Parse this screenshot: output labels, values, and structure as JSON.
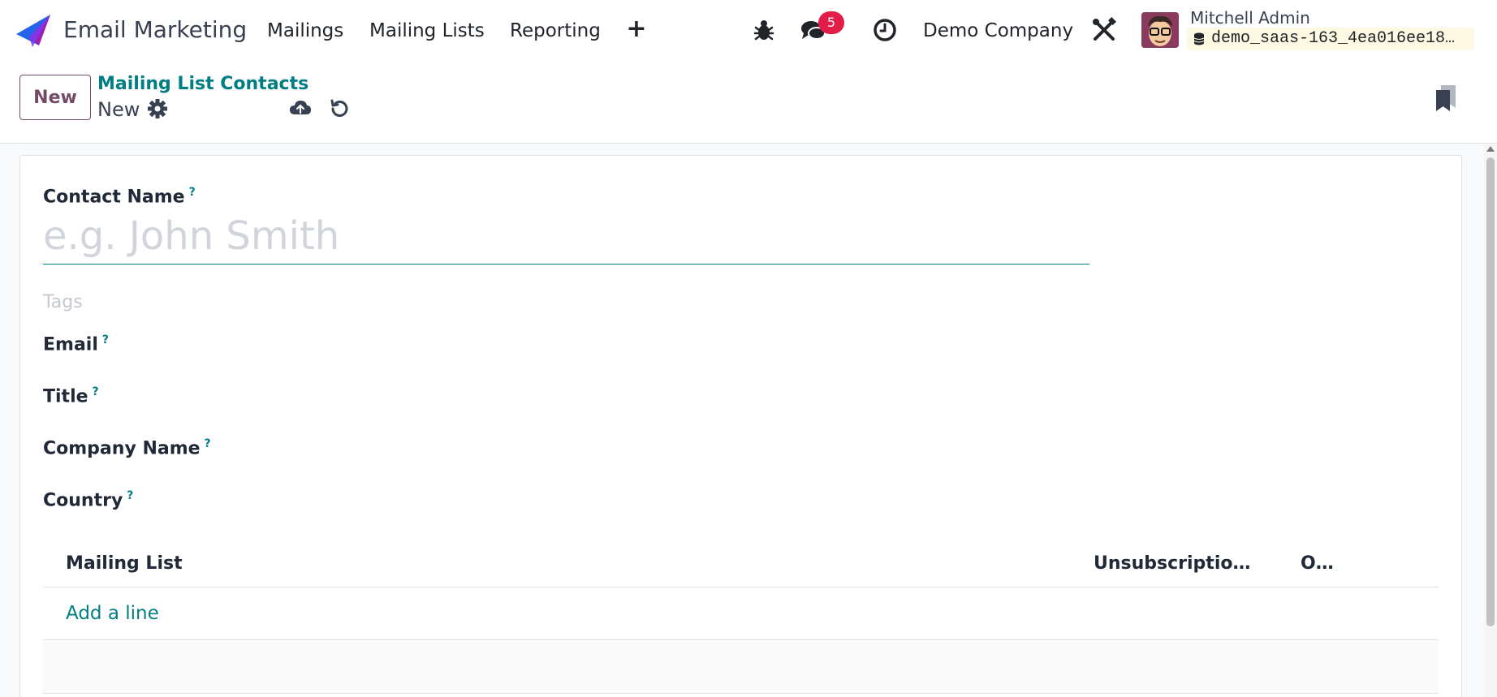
{
  "navbar": {
    "app_name": "Email Marketing",
    "menus": [
      "Mailings",
      "Mailing Lists",
      "Reporting"
    ],
    "plus_label": "+",
    "chat_badge": "5",
    "company": "Demo Company",
    "user_name": "Mitchell Admin",
    "database": "demo_saas-163_4ea016ee18…"
  },
  "control_panel": {
    "new_label": "New",
    "breadcrumb": "Mailing List Contacts",
    "record_name": "New"
  },
  "form": {
    "contact_name_label": "Contact Name",
    "contact_name_placeholder": "e.g. John Smith",
    "help_mark": "?",
    "tags_placeholder": "Tags",
    "email_label": "Email",
    "title_label": "Title",
    "company_name_label": "Company Name",
    "country_label": "Country"
  },
  "list": {
    "columns": [
      "Mailing List",
      "Unsubscriptio…",
      "O…"
    ],
    "add_line": "Add a line"
  },
  "colors": {
    "brand": "#714b67",
    "accent": "#017e84",
    "badge": "#e11d48"
  }
}
